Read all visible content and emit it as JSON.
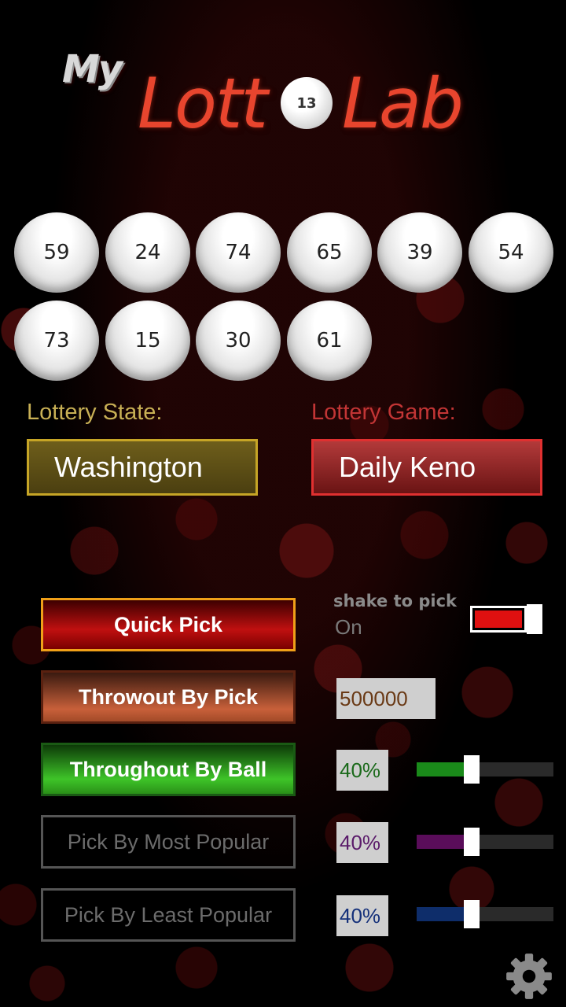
{
  "logo": {
    "my": "My",
    "lott": "Lott",
    "ball_number": "13",
    "lab": "Lab"
  },
  "balls": [
    "59",
    "24",
    "74",
    "65",
    "39",
    "54",
    "73",
    "15",
    "30",
    "61"
  ],
  "lottery_state": {
    "label": "Lottery State:",
    "value": "Washington"
  },
  "lottery_game": {
    "label": "Lottery Game:",
    "value": "Daily Keno"
  },
  "buttons": {
    "quick_pick": "Quick Pick",
    "throwout_by_pick": "Throwout By Pick",
    "throughout_by_ball": "Throughout By Ball",
    "pick_by_most_popular": "Pick By Most Popular",
    "pick_by_least_popular": "Pick By Least Popular"
  },
  "shake": {
    "label": "shake to pick",
    "state": "On",
    "enabled": true
  },
  "throwout_pick_value": "500000",
  "sliders": {
    "by_ball": {
      "text": "40%",
      "value": 0.4,
      "color": "#1a8a1a"
    },
    "most_popular": {
      "text": "40%",
      "value": 0.4,
      "color": "#5a0d5a"
    },
    "least_popular": {
      "text": "40%",
      "value": 0.4,
      "color": "#0e2d6a"
    }
  },
  "colors": {
    "accent_red": "#e01010",
    "state_gold": "#c6a526",
    "game_red": "#e03030"
  },
  "icons": {
    "settings": "gear-icon"
  }
}
